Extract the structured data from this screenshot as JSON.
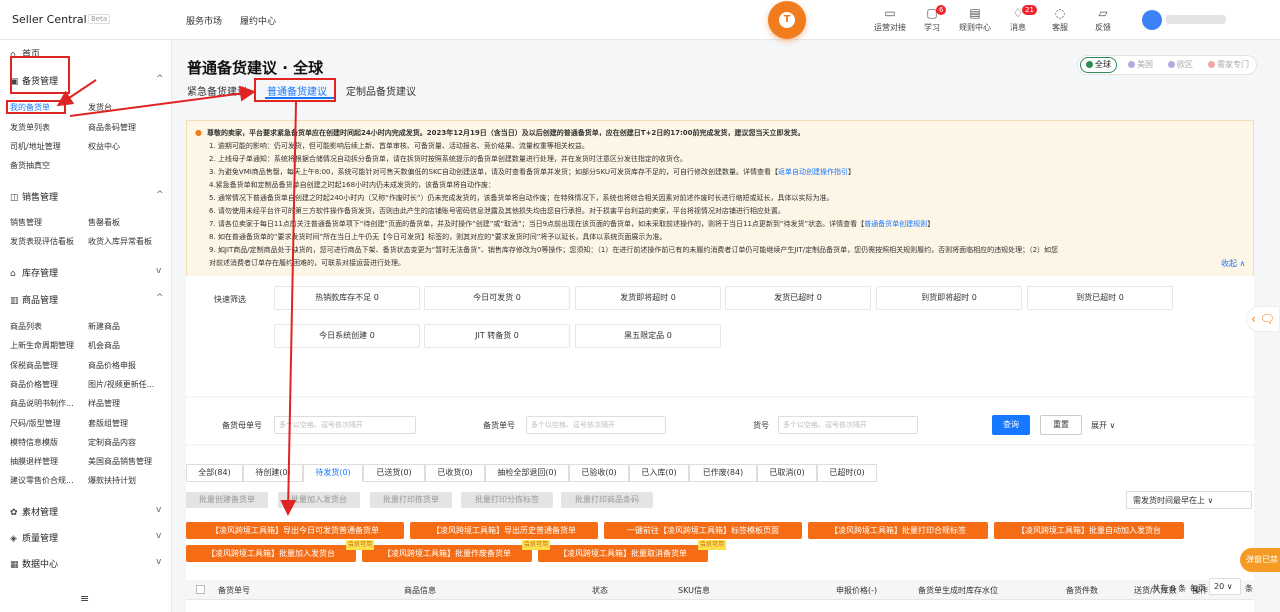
{
  "topbar": {
    "brand": "Seller Central",
    "beta": "Beta",
    "nav": [
      "服务市场",
      "履约中心"
    ],
    "logo_letter": "T",
    "icons": [
      {
        "label": "运营对接",
        "badge": ""
      },
      {
        "label": "学习",
        "badge": "6"
      },
      {
        "label": "规则中心",
        "badge": ""
      },
      {
        "label": "消息",
        "badge": "21"
      },
      {
        "label": "客服",
        "badge": ""
      },
      {
        "label": "反馈",
        "badge": ""
      }
    ]
  },
  "sidebar": {
    "home": "首页",
    "stock": {
      "title": "备货管理",
      "items": [
        "我的备货单",
        "发货台",
        "发货单列表",
        "商品条码管理",
        "司机/地址管理",
        "权益中心",
        "备货抽真空"
      ]
    },
    "sales": {
      "title": "销售管理",
      "items": [
        "销售管理",
        "售罄看板",
        "发货表现评估看板",
        "收货入库异常看板"
      ]
    },
    "inventory": {
      "title": "库存管理"
    },
    "goods": {
      "title": "商品管理",
      "items": [
        "商品列表",
        "新建商品",
        "上新生命周期管理",
        "机会商品",
        "保税商品管理",
        "商品价格申报",
        "商品价格管理",
        "图片/视频更新任...",
        "商品说明书制作...",
        "样品管理",
        "尺码/版型管理",
        "套版组管理",
        "模特信息模版",
        "定制商品内容",
        "抽膜退样管理",
        "美国商品销售管理",
        "建议零售价合规...",
        "爆款扶持计划"
      ]
    },
    "material": {
      "title": "素材管理"
    },
    "quality": {
      "title": "质量管理"
    },
    "data": {
      "title": "数据中心"
    },
    "collapse_icon": "≡"
  },
  "page": {
    "title": "普通备货建议 · 全球",
    "tabs": [
      "紧急备货建议",
      "普通备货建议",
      "定制品备货建议"
    ],
    "regions": [
      {
        "label": "全球",
        "color": "#2f8a5a"
      },
      {
        "label": "美国",
        "color": "#b9a7e0"
      },
      {
        "label": "欧区",
        "color": "#b9a7e0"
      },
      {
        "label": "需家专门",
        "color": "#f2a6a6"
      }
    ]
  },
  "notice": {
    "lines": [
      "尊敬的卖家，平台要求紧急备货单应在创建时间起24小时内完成发货。2023年12月19日（含当日）及以后创建的普通备货单，应在创建日T+2日的17:00前完成发货，建议您当天立即发货。",
      "1. 逾期可能的影响：仍可发货，但可能影响后续上新、首单审核、可备货量、活动报名、竞价结果、流量权重等相关权益。",
      "2. 上线母子单通知：系统将根据合储情况自动拆分备货单，请在拆货时按照系统提示的备货单创建数量进行处理，并在发货时注意区分发往指定的收货仓。",
      "3. 为避免VMI商品售罄，每天上午8:00，系统可能针对可售天数偏低的SKC自动创建送单，请及时查看备货单并发货；如部分SKU可发货库存不足的，可自行修改创建数量。详情查看【",
      "4.紧急备货单和定制品备货单自创建之时起168小时内仍未成发货的，该备货单将自动作废：",
      "5. 通常情况下普通备货单自创建之时起240小时内（又称“作废时长”）仍未完成发货的，该备货单将自动作废；在特殊情况下，系统也将综合相关因素对前述作废时长进行缩短或延长，具体以实际为准。",
      "6. 请勿使用未经平台许可的第三方软件操作备货发货，否则由此产生的店铺账号密码信息泄露及其他损失均由您自行承担。对于损害平台利益的卖家，平台将视情况对店铺进行相应处置。",
      "7. 请各位卖家于每日11点前关注普通备货单项下“待创建”页面的备货单，并及时操作“创建”或“取消”；当日9点前出现在该页面的备货单，如未采取前述操作的，则将于当日11点更新到“待发货”状态。详情查看【",
      "8. 如在普通备货单的“要求发货时间”所在当日上午仍无【今日可发货】标签的，则其对应的“要求发货时间”将予以延长，具体以系统页面展示为准。",
      "9. 如JIT商品/定制商品处于缺货的，您可进行商品下架、备货状态变更为“暂时无法备货”、销售库存修改为0等操作；您须知：（1）在进行前述操作前已有的未履约消费者订单仍可能继续产生JIT/定制品备货单，您仍需按照相关规则履约，否则将面临相应的违规处理；（2）如您",
      "对前述消费者订单存在履约困难的，可联系对接运营进行处理。"
    ],
    "link3": "返单自动创建操作指引",
    "link7": "普通备货单创建规则",
    "collapse": "收起 ∧"
  },
  "quick": {
    "label": "快速筛选",
    "row1": [
      "热销款库存不足 0",
      "今日可发货 0",
      "发货即将超时 0",
      "发货已超时 0",
      "到货即将超时 0",
      "到货已超时 0"
    ],
    "row2": [
      "今日系统创建 0",
      "JIT 转备货 0",
      "黑五限定品 0"
    ]
  },
  "search": {
    "f1": "备货母单号",
    "f2": "备货单号",
    "f3": "货号",
    "ph": "多个以空格、逗号依次隔开",
    "query": "查询",
    "reset": "重置",
    "expand": "展开 ∨"
  },
  "status_tabs": [
    "全部(84)",
    "待创建(0)",
    "待发货(0)",
    "已送货(0)",
    "已收货(0)",
    "抽检全部退回(0)",
    "已验收(0)",
    "已入库(0)",
    "已作废(84)",
    "已取消(0)",
    "已超时(0)"
  ],
  "batch": [
    "批量创建备货单",
    "批量加入发货台",
    "批量打印拣货单",
    "批量打印分拣标签",
    "批量打印商品条码"
  ],
  "sort": "需发货时间最早在上 ∨",
  "orange": [
    "【凌风跨境工具箱】导出今日可发货普通备货单",
    "【凌风跨境工具箱】导出历史普通备货单",
    "一键前往【凌风跨境工具箱】标签模板页面",
    "【凌风跨境工具箱】批量打印合规标签",
    "【凌风跨境工具箱】批量自动加入发货台",
    "【凌风跨境工具箱】批量加入发货台",
    "【凌风跨境工具箱】批量作废备货单",
    "【凌风跨境工具箱】批量取消备货单"
  ],
  "tag": "会员可用",
  "table_headers": [
    "备货单号",
    "商品信息",
    "状态",
    "SKU信息",
    "申报价格(-)",
    "备货单生成时库存水位",
    "备货件数",
    "送货/入库数",
    "操作"
  ],
  "pager": {
    "total": "共有 0 条",
    "per": "每页",
    "size": "20 ∨",
    "unit": "条"
  },
  "popup": "弹窗已禁",
  "side_tool": "‹ 🗨"
}
